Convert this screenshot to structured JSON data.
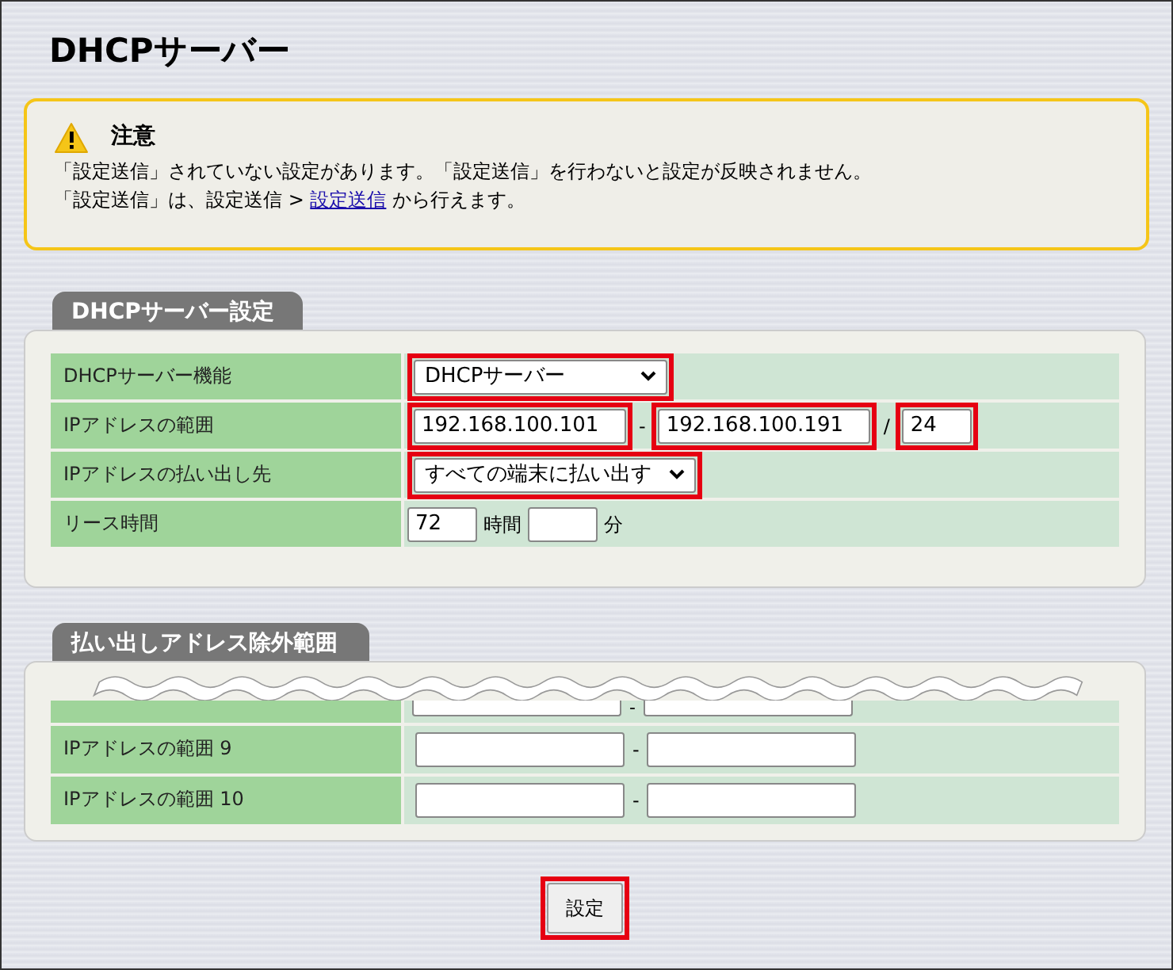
{
  "title": "DHCPサーバー",
  "notice": {
    "heading": "注意",
    "line1": "「設定送信」されていない設定があります。「設定送信」を行わないと設定が反映されません。",
    "line2_before": "「設定送信」は、設定送信 > ",
    "link": "設定送信",
    "line2_after": " から行えます。"
  },
  "server_settings": {
    "tab": "DHCPサーバー設定",
    "rows": [
      {
        "kind": "select",
        "label": "DHCPサーバー機能",
        "value": "DHCPサーバー",
        "highlighted": true
      },
      {
        "kind": "range",
        "label": "IPアドレスの範囲",
        "start": "192.168.100.101",
        "separator": "-",
        "end": "192.168.100.191",
        "slash": "/",
        "prefix": "24",
        "highlighted": true
      },
      {
        "kind": "select",
        "label": "IPアドレスの払い出し先",
        "value": "すべての端末に払い出す",
        "highlighted": true
      },
      {
        "kind": "lease",
        "label": "リース時間",
        "hours": "72",
        "hours_unit": "時間",
        "minutes_unit": "分"
      }
    ]
  },
  "exclusion": {
    "tab": "払い出しアドレス除外範囲",
    "rows": [
      {
        "separator": "-"
      },
      {
        "label": "IPアドレスの範囲 9",
        "separator": "-"
      },
      {
        "label": "IPアドレスの範囲 10",
        "separator": "-"
      }
    ]
  },
  "submit": {
    "label": "設定",
    "highlighted": true
  }
}
